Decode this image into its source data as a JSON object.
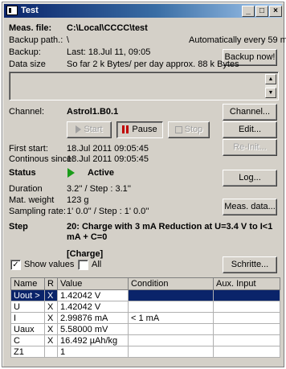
{
  "window": {
    "title": "Test",
    "controls": {
      "minimize": "_",
      "maximize": "□",
      "close": "×"
    }
  },
  "meas_file": {
    "label": "Meas. file:",
    "value": "C:\\Local\\CCCC\\test"
  },
  "backup_path": {
    "label": "Backup path.:",
    "value": "\\",
    "auto_text": "Automatically every 59 min"
  },
  "backup": {
    "label": "Backup:",
    "value": "Last: 18.Jul 11, 09:05",
    "button": "Backup now!"
  },
  "data_size": {
    "label": "Data size",
    "value": "So far 2 k Bytes/ per day approx. 88 k Bytes"
  },
  "channel": {
    "label": "Channel:",
    "value": "Astrol1.B0.1",
    "button": "Channel..."
  },
  "controls": {
    "start": "Start",
    "pause": "Pause",
    "stop": "Stop",
    "edit": "Edit...",
    "reinit": "Re-Init..."
  },
  "first_start": {
    "label": "First start:",
    "value": "18.Jul 2011 09:05:45"
  },
  "continuous_since": {
    "label": "Continous since:",
    "value": "18.Jul 2011 09:05:45"
  },
  "status": {
    "label": "Status",
    "value": "Active",
    "log_button": "Log..."
  },
  "duration": {
    "label": "Duration",
    "value": "3.2'' / Step : 3.1''"
  },
  "mat_weight": {
    "label": "Mat. weight",
    "value": "123 g"
  },
  "sampling_rate": {
    "label": "Sampling rate:",
    "value": "1' 0.0'' / Step : 1' 0.0''",
    "button": "Meas. data..."
  },
  "step": {
    "label": "Step",
    "line1": "20: Charge with 3 mA Reduction at U=3.4 V to I<1",
    "line2": "mA + C=0",
    "type": "[Charge]",
    "button": "Schritte..."
  },
  "options": {
    "show_values": "Show values",
    "show_values_checked": true,
    "all": "All",
    "all_checked": false
  },
  "table": {
    "headers": [
      "Name",
      "R",
      "Value",
      "Condition",
      "Aux. Input"
    ],
    "rows": [
      {
        "name": "Uout >",
        "r": "X",
        "value": "1.42042 V",
        "condition": "",
        "aux": ""
      },
      {
        "name": "U",
        "r": "X",
        "value": "1.42042 V",
        "condition": "",
        "aux": ""
      },
      {
        "name": "I",
        "r": "X",
        "value": "2.99876 mA",
        "condition": "< 1 mA",
        "aux": ""
      },
      {
        "name": "Uaux",
        "r": "X",
        "value": "5.58000 mV",
        "condition": "",
        "aux": ""
      },
      {
        "name": "C",
        "r": "X",
        "value": "16.492 µAh/kg",
        "condition": "",
        "aux": ""
      },
      {
        "name": "Z1",
        "r": "",
        "value": "1",
        "condition": "",
        "aux": ""
      }
    ]
  }
}
